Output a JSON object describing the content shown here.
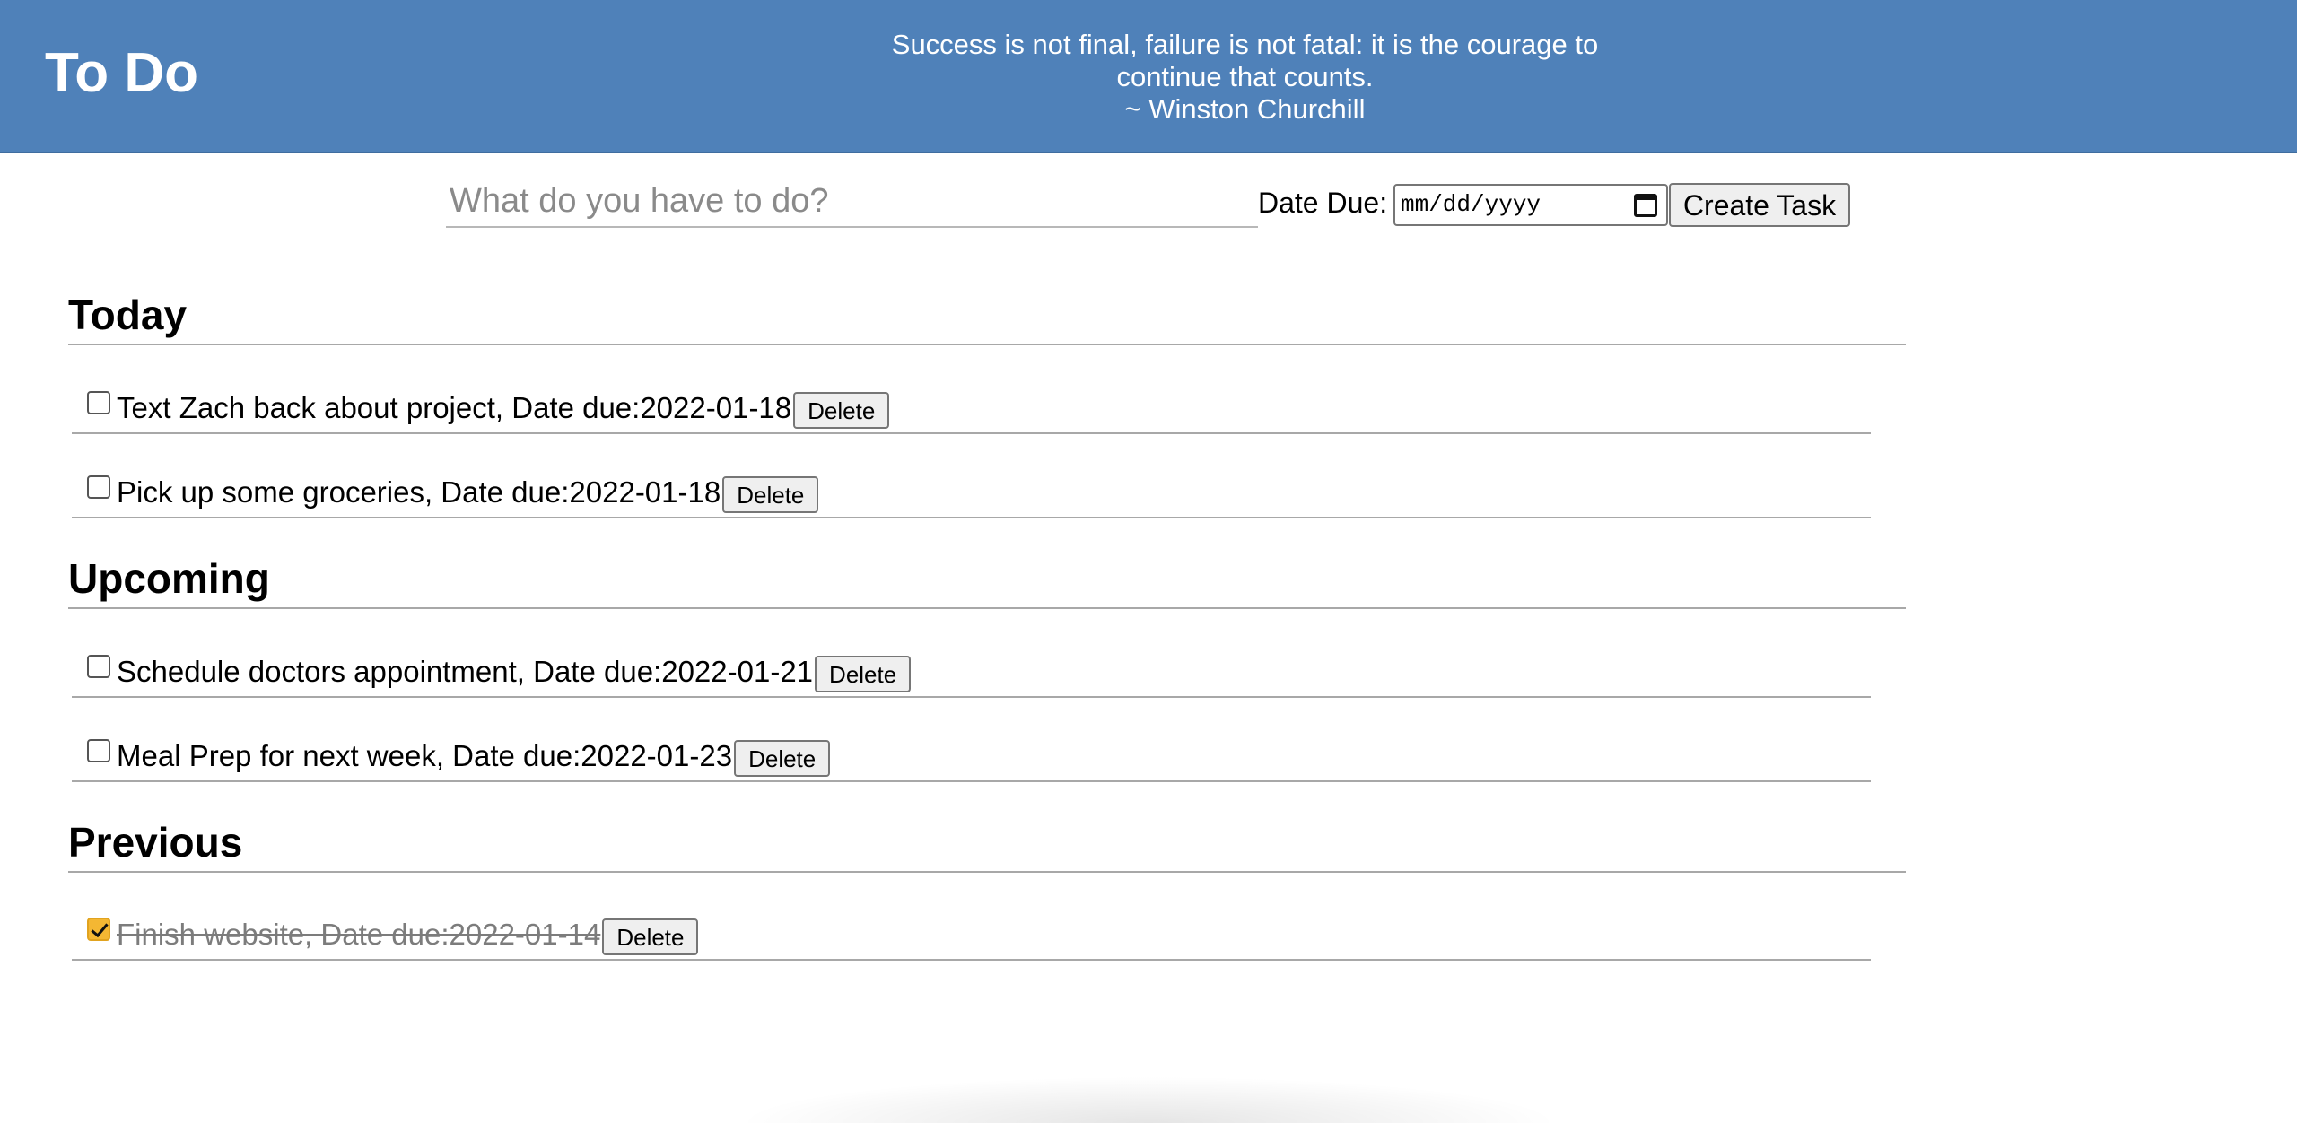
{
  "header": {
    "title": "To Do",
    "quote_line1": "Success is not final, failure is not fatal: it is the courage to",
    "quote_line2": "continue that counts.",
    "quote_author": "~ Winston Churchill",
    "background_color": "#4f81b9"
  },
  "form": {
    "task_placeholder": "What do you have to do?",
    "task_value": "",
    "date_label": "Date Due:",
    "date_placeholder": "mm/dd/yyyy",
    "date_value": "",
    "create_label": "Create Task"
  },
  "sections": {
    "today": {
      "title": "Today",
      "tasks": [
        {
          "label": "Text Zach back about project, Date due:2022-01-18",
          "checked": false,
          "delete_label": "Delete"
        },
        {
          "label": "Pick up some groceries, Date due:2022-01-18",
          "checked": false,
          "delete_label": "Delete"
        }
      ]
    },
    "upcoming": {
      "title": "Upcoming",
      "tasks": [
        {
          "label": "Schedule doctors appointment, Date due:2022-01-21",
          "checked": false,
          "delete_label": "Delete"
        },
        {
          "label": "Meal Prep for next week, Date due:2022-01-23",
          "checked": false,
          "delete_label": "Delete"
        }
      ]
    },
    "previous": {
      "title": "Previous",
      "tasks": [
        {
          "label": "Finish website, Date due:2022-01-14",
          "checked": true,
          "delete_label": "Delete"
        }
      ]
    }
  },
  "icons": {
    "date_picker": "calendar-icon",
    "checkbox_checked": "checkmark-icon"
  },
  "colors": {
    "checked_accent": "#f4b733"
  }
}
